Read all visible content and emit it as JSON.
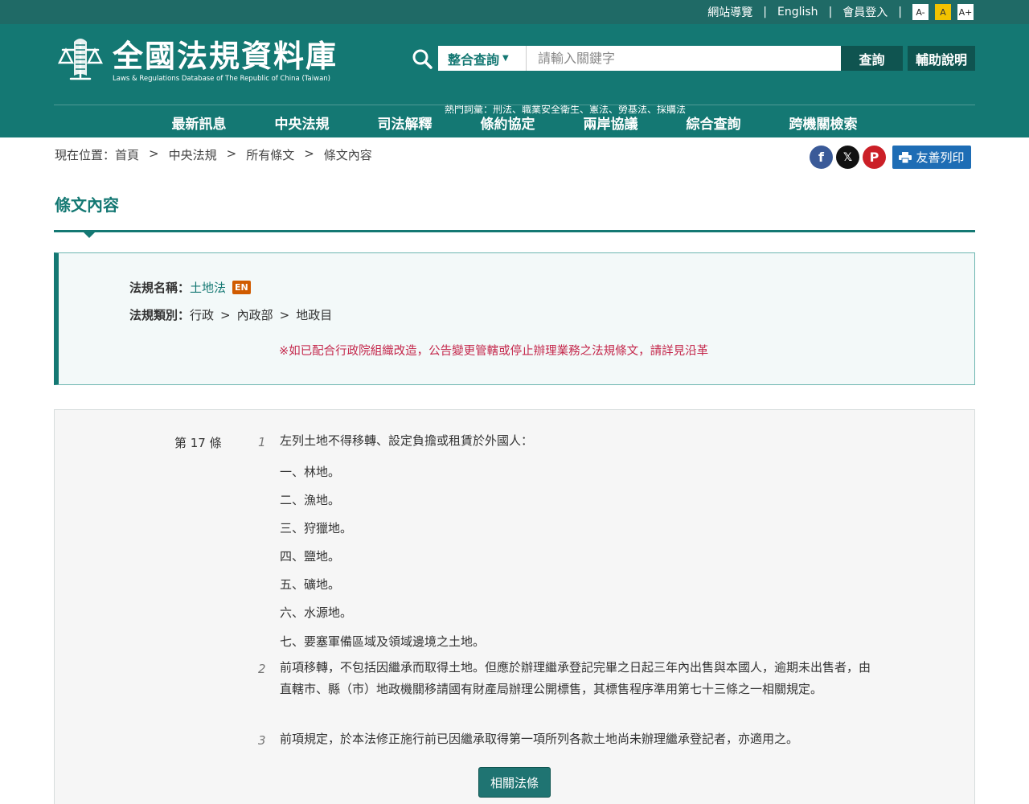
{
  "topbar": {
    "sitemap": "網站導覽",
    "english": "English",
    "login": "會員登入",
    "font_small": "A-",
    "font_normal": "A",
    "font_large": "A+"
  },
  "logo": {
    "title": "全國法規資料庫",
    "subtitle": "Laws & Regulations Database of The Republic of China (Taiwan)"
  },
  "search": {
    "scope": "整合查詢",
    "placeholder": "請輸入關鍵字",
    "submit": "查詢",
    "help": "輔助說明",
    "hot_terms": "熱門詞彙：刑法、職業安全衛生、憲法、勞基法、採購法"
  },
  "nav": [
    "最新訊息",
    "中央法規",
    "司法解釋",
    "條約協定",
    "兩岸協議",
    "綜合查詢",
    "跨機關檢索"
  ],
  "breadcrumb": {
    "prefix": "現在位置：",
    "items": [
      "首頁",
      "中央法規",
      "所有條文",
      "條文內容"
    ],
    "sep": ">"
  },
  "share": {
    "print": "友善列印",
    "icons": [
      "facebook-icon",
      "x-icon",
      "plurk-icon",
      "line-icon"
    ]
  },
  "page_title": "條文內容",
  "law": {
    "name_label": "法規名稱：",
    "name": "土地法",
    "en_badge": "EN",
    "category_label": "法規類別：",
    "category": [
      "行政",
      "內政部",
      "地政目"
    ],
    "category_sep": ">",
    "notice": "※如已配合行政院組織改造，公告變更管轄或停止辦理業務之法規條文，請詳見沿革"
  },
  "article": {
    "number": "第 17 條",
    "paragraphs": [
      {
        "num": "1",
        "text": "左列土地不得移轉、設定負擔或租賃於外國人："
      },
      {
        "num": "2",
        "text": "前項移轉，不包括因繼承而取得土地。但應於辦理繼承登記完畢之日起三年內出售與本國人，逾期未出售者，由直轄市、縣（市）地政機關移請國有財產局辦理公開標售，其標售程序準用第七十三條之一相關規定。"
      },
      {
        "num": "3",
        "text": "前項規定，於本法修正施行前已因繼承取得第一項所列各款土地尚未辦理繼承登記者，亦適用之。"
      }
    ],
    "items": [
      "一、林地。",
      "二、漁地。",
      "三、狩獵地。",
      "四、鹽地。",
      "五、礦地。",
      "六、水源地。",
      "七、要塞軍備區域及領域邊境之土地。"
    ],
    "related_button": "相關法條"
  },
  "colors": {
    "brand": "#147873",
    "brand_dark": "#0f5450",
    "notice": "#c4284c",
    "en_badge": "#d05b00",
    "print_button": "#1e6db5"
  }
}
